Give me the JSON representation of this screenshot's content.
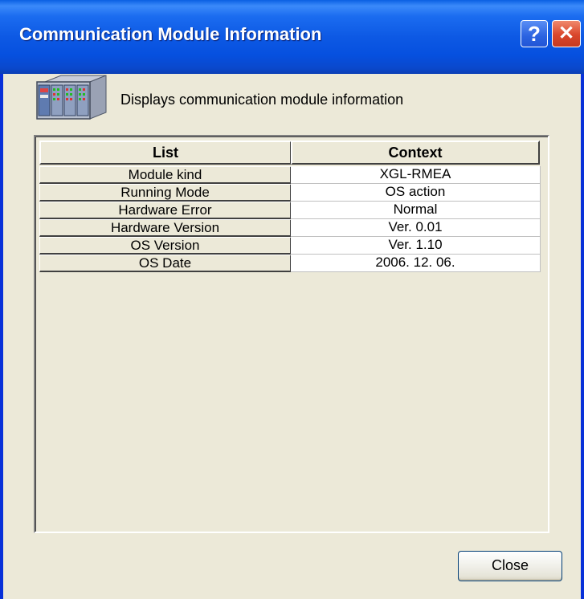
{
  "window": {
    "title": "Communication Module Information",
    "help_glyph": "?",
    "close_glyph": "✕"
  },
  "header": {
    "icon": "plc-module-icon",
    "description": "Displays communication module information"
  },
  "table": {
    "columns": [
      "List",
      "Context"
    ],
    "rows": [
      {
        "label": "Module kind",
        "value": "XGL-RMEA"
      },
      {
        "label": "Running Mode",
        "value": "OS action"
      },
      {
        "label": "Hardware Error",
        "value": "Normal"
      },
      {
        "label": "Hardware Version",
        "value": "Ver. 0.01"
      },
      {
        "label": "OS Version",
        "value": "Ver. 1.10"
      },
      {
        "label": "OS Date",
        "value": "2006. 12. 06."
      }
    ]
  },
  "footer": {
    "close_label": "Close"
  },
  "colors": {
    "titlebar": "#0a55e0",
    "dialog_bg": "#ece9d8",
    "close_x": "#d9462b"
  }
}
